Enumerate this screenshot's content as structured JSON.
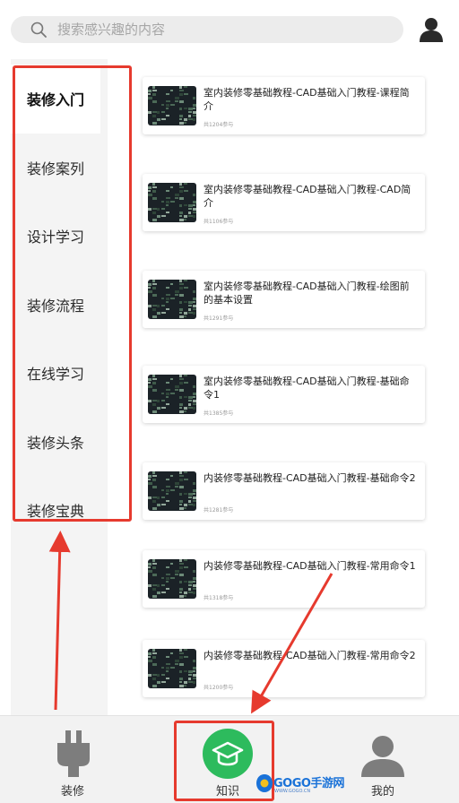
{
  "search": {
    "placeholder": "搜索感兴趣的内容"
  },
  "categories": [
    {
      "label": "装修入门",
      "active": true
    },
    {
      "label": "装修案列",
      "active": false
    },
    {
      "label": "设计学习",
      "active": false
    },
    {
      "label": "装修流程",
      "active": false
    },
    {
      "label": "在线学习",
      "active": false
    },
    {
      "label": "装修头条",
      "active": false
    },
    {
      "label": "装修宝典",
      "active": false
    }
  ],
  "courses": [
    {
      "title": "室内装修零基础教程-CAD基础入门教程-课程简介",
      "meta": "共1204参与"
    },
    {
      "title": "室内装修零基础教程-CAD基础入门教程-CAD简介",
      "meta": "共1106参与"
    },
    {
      "title": "室内装修零基础教程-CAD基础入门教程-绘图前的基本设置",
      "meta": "共1291参与"
    },
    {
      "title": "室内装修零基础教程-CAD基础入门教程-基础命令1",
      "meta": "共1385参与"
    },
    {
      "title": "内装修零基础教程-CAD基础入门教程-基础命令2",
      "meta": "共1281参与"
    },
    {
      "title": "内装修零基础教程-CAD基础入门教程-常用命令1",
      "meta": "共1318参与"
    },
    {
      "title": "内装修零基础教程-CAD基础入门教程-常用命令2",
      "meta": "共1200参与"
    }
  ],
  "bottom_nav": {
    "zhuangxiu": "装修",
    "zhishi": "知识",
    "wode": "我的"
  },
  "watermark": {
    "text": "GOGO手游网",
    "sub": "WWW.GOGO.CN"
  },
  "colors": {
    "accent_green": "#2dbb5d",
    "annotation_red": "#e63a2e",
    "sidebar_bg": "#f4f4f4",
    "nav_bg": "#f2f2f2"
  }
}
